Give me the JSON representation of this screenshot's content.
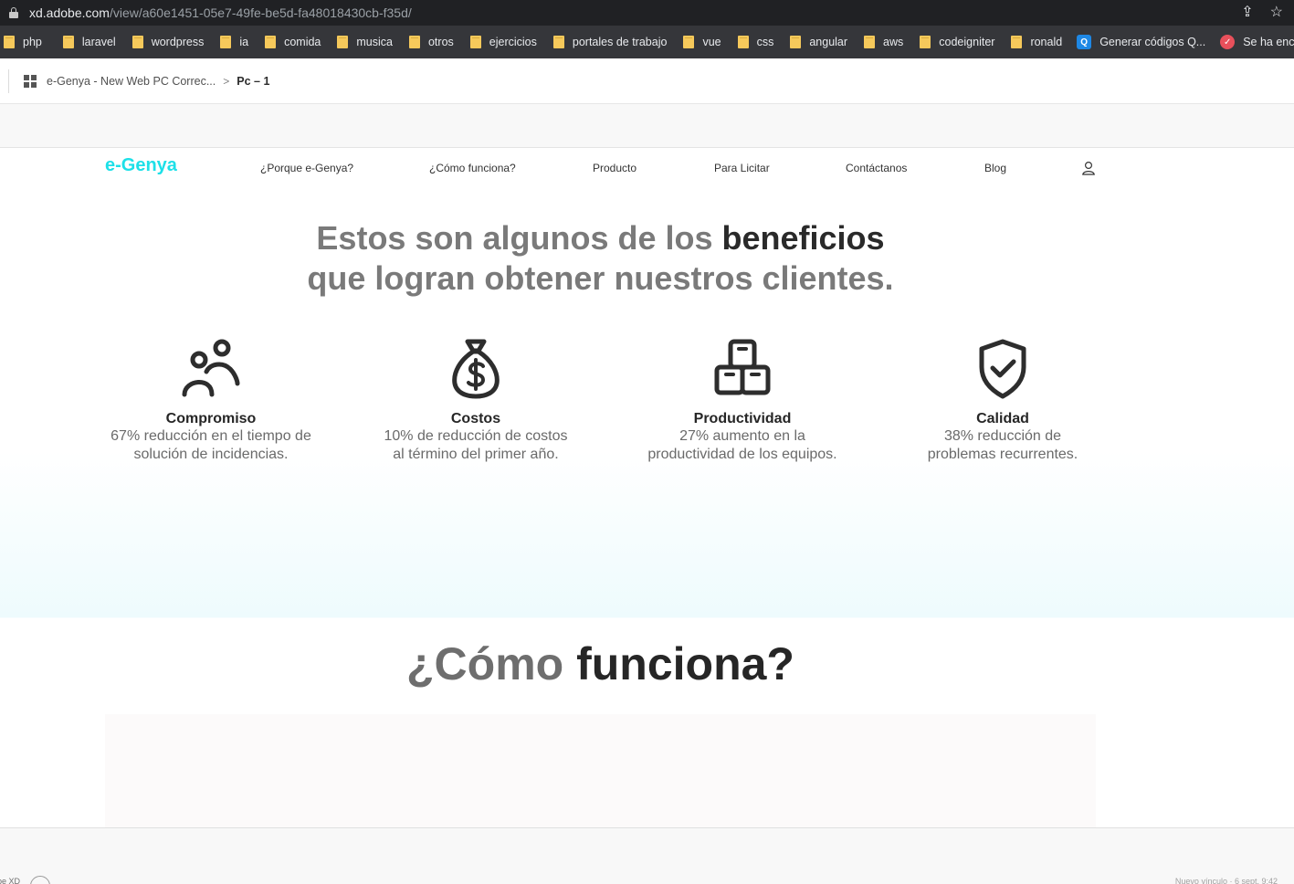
{
  "browser": {
    "url_host": "xd.adobe.com",
    "url_path": "/view/a60e1451-05e7-49fe-be5d-fa48018430cb-f35d/",
    "bookmarks": [
      {
        "label": "php",
        "icon": "folder-icon"
      },
      {
        "label": "laravel",
        "icon": "folder-icon"
      },
      {
        "label": "wordpress",
        "icon": "folder-icon"
      },
      {
        "label": "ia",
        "icon": "folder-icon"
      },
      {
        "label": "comida",
        "icon": "folder-icon"
      },
      {
        "label": "musica",
        "icon": "folder-icon"
      },
      {
        "label": "otros",
        "icon": "folder-icon"
      },
      {
        "label": "ejercicios",
        "icon": "folder-icon"
      },
      {
        "label": "portales de trabajo",
        "icon": "folder-icon"
      },
      {
        "label": "vue",
        "icon": "folder-icon"
      },
      {
        "label": "css",
        "icon": "folder-icon"
      },
      {
        "label": "angular",
        "icon": "folder-icon"
      },
      {
        "label": "aws",
        "icon": "folder-icon"
      },
      {
        "label": "codeigniter",
        "icon": "folder-icon"
      },
      {
        "label": "ronald",
        "icon": "folder-icon"
      },
      {
        "label": "Generar códigos Q...",
        "icon": "qr-site-icon"
      },
      {
        "label": "Se ha encontrad",
        "icon": "red-check-icon"
      }
    ]
  },
  "xd": {
    "breadcrumb_project": "e-Genya - New Web PC Correc...",
    "breadcrumb_separator": ">",
    "breadcrumb_current": "Pc – 1",
    "footer_app": "pe XD",
    "footer_note": "Nuevo vínculo · 6 sept. 9:42"
  },
  "site": {
    "logo": "e-Genya",
    "nav": [
      "¿Porque e-Genya?",
      "¿Cómo funciona?",
      "Producto",
      "Para Licitar",
      "Contáctanos",
      "Blog"
    ],
    "hero": {
      "line1_gray": "Estos son algunos de los",
      "line1_bold": "beneficios",
      "line2": "que logran obtener nuestros clientes."
    },
    "benefits": [
      {
        "icon": "people-icon",
        "title": "Compromiso",
        "desc1": "67% reducción en el tiempo de",
        "desc2": "solución de incidencias."
      },
      {
        "icon": "money-bag-icon",
        "title": "Costos",
        "desc1": "10% de reducción de costos",
        "desc2": "al término del primer año."
      },
      {
        "icon": "boxes-icon",
        "title": "Productividad",
        "desc1": "27% aumento en la",
        "desc2": "productividad de los equipos."
      },
      {
        "icon": "shield-check-icon",
        "title": "Calidad",
        "desc1": "38% reducción de",
        "desc2": "problemas recurrentes."
      }
    ],
    "how": {
      "gray": "¿Cómo",
      "bold": "funciona?"
    }
  },
  "colors": {
    "brand": "#1de0e8",
    "chrome_dark": "#202124",
    "bookmarks_bg": "#35363a",
    "folder": "#f6c95b",
    "benefits_gradient_end": "#eefbfd"
  }
}
